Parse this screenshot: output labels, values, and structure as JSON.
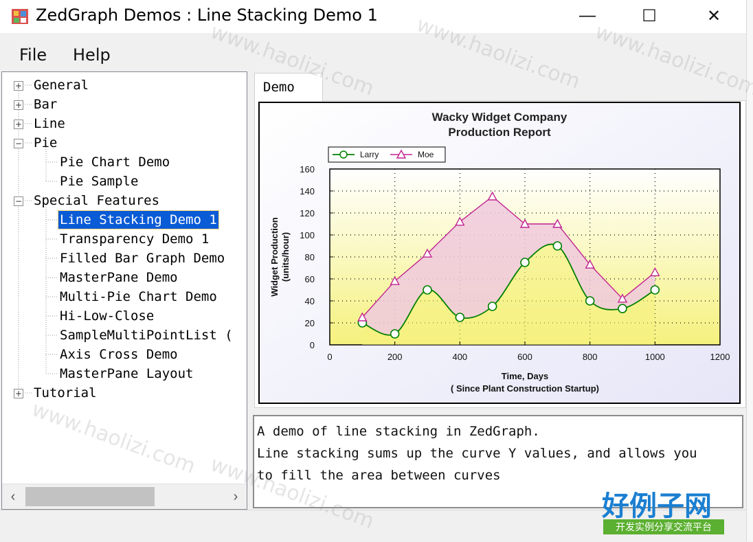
{
  "window": {
    "title": "ZedGraph Demos : Line Stacking Demo 1",
    "minimize_glyph": "—",
    "maximize_glyph": "☐",
    "close_glyph": "✕"
  },
  "menu": {
    "file": "File",
    "help": "Help"
  },
  "tree": {
    "general": "General",
    "bar": "Bar",
    "line": "Line",
    "pie": "Pie",
    "pie_chart_demo": "Pie Chart Demo",
    "pie_sample": "Pie Sample",
    "special_features": "Special Features",
    "line_stacking_demo_1": "Line Stacking Demo 1",
    "transparency_demo_1": "Transparency Demo 1",
    "filled_bar_graph_demo": "Filled Bar Graph Demo",
    "masterpane_demo": "MasterPane Demo",
    "multi_pie_chart_demo": "Multi-Pie Chart Demo",
    "hi_low_close": "Hi-Low-Close",
    "sample_multipointlist": "SampleMultiPointList (",
    "axis_cross_demo": "Axis Cross Demo",
    "masterpane_layout": "MasterPane Layout",
    "tutorial": "Tutorial",
    "plus": "+",
    "minus": "−"
  },
  "tab": {
    "label": "Demo"
  },
  "description": {
    "line1": "A demo of line stacking in ZedGraph.",
    "line2": "Line stacking sums up the curve Y values, and allows you",
    "line3": "to fill the area between curves"
  },
  "watermark": {
    "logo": "好例子网",
    "tagline": "开发实例分享交流平台",
    "url": "www.haolizi.com"
  },
  "chart_data": {
    "type": "line",
    "title": "Wacky Widget Company\nProduction Report",
    "xlabel": "Time, Days\n( Since Plant Construction Startup)",
    "ylabel": "Widget Production\n(units/hour)",
    "xlim": [
      0,
      1200
    ],
    "ylim": [
      0,
      160
    ],
    "xticks": [
      0,
      200,
      400,
      600,
      800,
      1000,
      1200
    ],
    "yticks": [
      0,
      20,
      40,
      60,
      80,
      100,
      120,
      140,
      160
    ],
    "grid": true,
    "legend": "top-left",
    "x": [
      100,
      200,
      300,
      400,
      500,
      600,
      700,
      800,
      900,
      1000
    ],
    "series": [
      {
        "name": "Larry",
        "marker": "circle",
        "color": "#008000",
        "values": [
          20,
          10,
          50,
          25,
          35,
          75,
          90,
          40,
          33,
          50
        ]
      },
      {
        "name": "Moe",
        "marker": "triangle",
        "color": "#c0228f",
        "values": [
          25,
          58,
          83,
          112,
          135,
          110,
          110,
          73,
          42,
          66
        ]
      }
    ],
    "colors": {
      "fill_top": "#ffffff",
      "fill_bottom": "#f5f17e",
      "pane_bg": "#e6e6f8",
      "stack_fill": "#f0c9de"
    }
  }
}
